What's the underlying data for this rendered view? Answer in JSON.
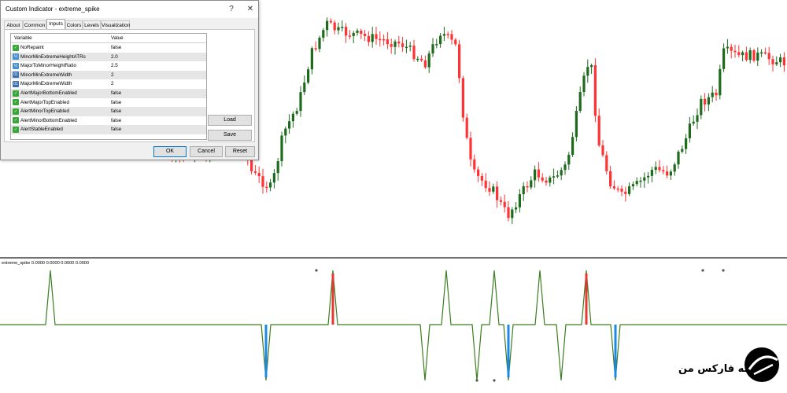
{
  "dialog": {
    "title": "Custom Indicator - extreme_spike",
    "help_label": "?",
    "close_label": "✕",
    "tabs": [
      "About",
      "Common",
      "Inputs",
      "Colors",
      "Levels",
      "Visualization"
    ],
    "active_tab": "Inputs",
    "columns": {
      "variable": "Variable",
      "value": "Value"
    },
    "rows": [
      {
        "name": "NoRepaint",
        "value": "false",
        "icon": "boolean-icon"
      },
      {
        "name": "MinorMinExtremeHeightATRs",
        "value": "2.0",
        "icon": "double-icon"
      },
      {
        "name": "MajorToMinorHeightRatio",
        "value": "2.5",
        "icon": "double-icon"
      },
      {
        "name": "MinorMinExtremeWidth",
        "value": "2",
        "icon": "integer-icon"
      },
      {
        "name": "MajorMinExtremeWidth",
        "value": "2",
        "icon": "integer-icon"
      },
      {
        "name": "AlertMajorBottomEnabled",
        "value": "false",
        "icon": "boolean-icon"
      },
      {
        "name": "AlertMajorTopEnabled",
        "value": "false",
        "icon": "boolean-icon"
      },
      {
        "name": "AlertMinorTopEnabled",
        "value": "false",
        "icon": "boolean-icon"
      },
      {
        "name": "AlertMinorBottomEnabled",
        "value": "false",
        "icon": "boolean-icon"
      },
      {
        "name": "AlertStableEnabled",
        "value": "false",
        "icon": "boolean-icon"
      }
    ],
    "buttons": {
      "load": "Load",
      "save": "Save",
      "ok": "OK",
      "cancel": "Cancel",
      "reset": "Reset"
    }
  },
  "indicator": {
    "label": "extreme_spike 0.0000 0.0000 0.0000 0.0000"
  },
  "logo": {
    "text": "خانه فارکس من"
  },
  "colors": {
    "bull": "#1e6b1e",
    "bear": "#ff3333",
    "indicator_line": "#3a7d1e",
    "spike_blue": "#1e88e5",
    "spike_red": "#e53935",
    "separator": "#6e6e6e"
  }
}
